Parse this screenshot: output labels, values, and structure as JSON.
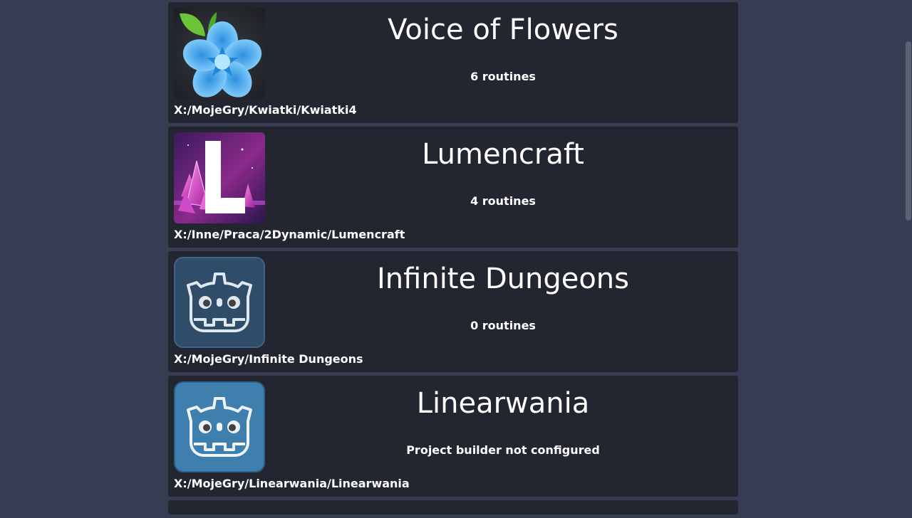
{
  "projects": [
    {
      "title": "Voice of Flowers",
      "status": "6 routines",
      "path": "X:/MojeGry/Kwiatki/Kwiatki4",
      "icon": "flower-icon"
    },
    {
      "title": "Lumencraft",
      "status": "4 routines",
      "path": "X:/Inne/Praca/2Dynamic/Lumencraft",
      "icon": "crystal-letter-l-icon"
    },
    {
      "title": "Infinite Dungeons",
      "status": "0 routines",
      "path": "X:/MojeGry/Infinite Dungeons",
      "icon": "godot-icon"
    },
    {
      "title": "Linearwania",
      "status": "Project builder not configured",
      "path": "X:/MojeGry/Linearwania/Linearwania",
      "icon": "godot-icon"
    }
  ],
  "colors": {
    "background": "#363d52",
    "card": "#232530",
    "godot_blue": "#478cbf",
    "flower_blue": "#5ab8f0"
  }
}
